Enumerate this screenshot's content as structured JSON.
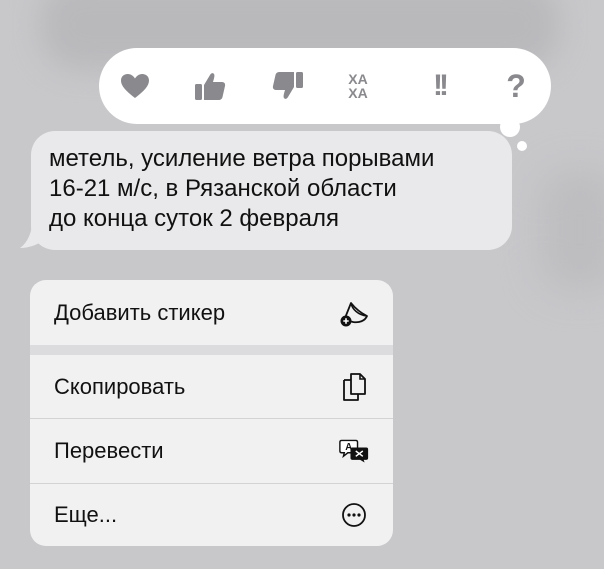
{
  "tapback": {
    "reactions": [
      {
        "name": "heart-icon"
      },
      {
        "name": "thumbs-up-icon"
      },
      {
        "name": "thumbs-down-icon"
      },
      {
        "name": "haha-icon",
        "line1": "ХА",
        "line2": "ХА"
      },
      {
        "name": "emphasize-icon",
        "text": "!!"
      },
      {
        "name": "question-icon",
        "text": "?"
      }
    ],
    "icon_color": "#8a8a8e"
  },
  "message": {
    "text": "метель, усиление ветра порывами\n16-21 м/с, в Рязанской области\nдо конца суток 2 февраля"
  },
  "menu": {
    "add_sticker": {
      "label": "Добавить стикер",
      "icon": "sticker-icon"
    },
    "copy": {
      "label": "Скопировать",
      "icon": "copy-icon"
    },
    "translate": {
      "label": "Перевести",
      "icon": "translate-icon"
    },
    "more": {
      "label": "Еще...",
      "icon": "ellipsis-circle-icon"
    }
  }
}
